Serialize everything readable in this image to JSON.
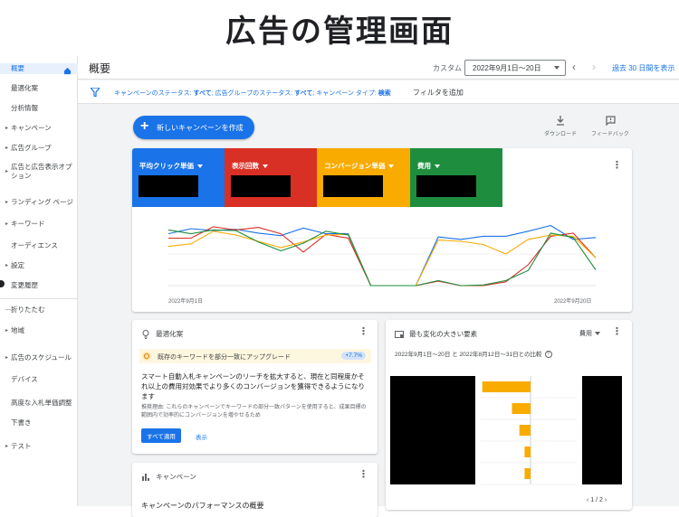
{
  "banner_title": "広告の管理画面",
  "sidebar": {
    "items": [
      {
        "label": "概要",
        "arrow": "",
        "active": true
      },
      {
        "label": "最適化案",
        "arrow": "",
        "sub": true
      },
      {
        "label": "分析情報",
        "arrow": "",
        "sub": true
      },
      {
        "label": "キャンペーン",
        "arrow": "▸"
      },
      {
        "label": "広告グループ",
        "arrow": "▸"
      },
      {
        "label": "広告と広告表示オプション",
        "arrow": "▸"
      },
      {
        "label": "ランディング ページ",
        "arrow": "▸"
      },
      {
        "label": "キーワード",
        "arrow": "▸"
      },
      {
        "label": "オーディエンス",
        "arrow": "",
        "sub": true
      },
      {
        "label": "設定",
        "arrow": "▸"
      },
      {
        "label": "変更履歴",
        "arrow": "",
        "sub": true
      },
      {
        "label": "折りたたむ",
        "arrow": "—"
      },
      {
        "label": "地域",
        "arrow": "▸"
      },
      {
        "label": "広告のスケジュール",
        "arrow": "▸"
      },
      {
        "label": "デバイス",
        "arrow": "",
        "sub": true
      },
      {
        "label": "高度な入札単価調整",
        "arrow": "",
        "sub": true
      },
      {
        "label": "下書き",
        "arrow": "",
        "sub": true
      },
      {
        "label": "テスト",
        "arrow": "▸"
      }
    ]
  },
  "header": {
    "title": "概要",
    "custom_label": "カスタム",
    "date_range": "2022年9月1日～20日",
    "last30": "過去 30 日間を表示"
  },
  "filterbar": {
    "status_text_1": "キャンペーンのステータス: ",
    "status_val_1": "すべて",
    "status_text_2": "; 広告グループのステータス: ",
    "status_val_2": "すべて",
    "status_text_3": "; キャンペーン タイプ: ",
    "status_val_3": "検索",
    "add_filter": "フィルタを追加"
  },
  "toolbar": {
    "new_campaign": "新しいキャンペーンを作成",
    "download": "ダウンロード",
    "feedback": "フィードバック"
  },
  "metrics": [
    {
      "label": "平均クリック単価",
      "color": "#1a73e8"
    },
    {
      "label": "表示回数",
      "color": "#d93025"
    },
    {
      "label": "コンバージョン単価",
      "color": "#f9ab00"
    },
    {
      "label": "費用",
      "color": "#1e8e3e"
    }
  ],
  "chart_data": {
    "type": "line",
    "x": [
      "2022年9月1日",
      "",
      "",
      "",
      "",
      "",
      "",
      "",
      "",
      "",
      "",
      "",
      "",
      "",
      "",
      "",
      "",
      "",
      "",
      "2022年9月20日"
    ],
    "x_start_label": "2022年9月1日",
    "x_end_label": "2022年9月20日",
    "series": [
      {
        "color": "#1a73e8",
        "values": [
          0.82,
          0.9,
          0.87,
          0.89,
          0.83,
          0.79,
          0.91,
          0.82,
          0.82,
          0.0,
          0.0,
          0.0,
          0.77,
          0.73,
          0.78,
          0.78,
          0.86,
          0.95,
          0.73,
          0.76
        ]
      },
      {
        "color": "#d93025",
        "values": [
          0.75,
          0.75,
          0.93,
          0.88,
          0.92,
          0.82,
          0.53,
          0.81,
          0.75,
          0.0,
          0.0,
          0.0,
          0.07,
          0.0,
          0.0,
          0.06,
          0.33,
          0.78,
          0.83,
          0.44
        ]
      },
      {
        "color": "#f9ab00",
        "values": [
          0.62,
          0.66,
          0.86,
          0.8,
          0.7,
          0.6,
          0.69,
          0.8,
          0.81,
          0.0,
          0.0,
          0.0,
          0.72,
          0.7,
          0.65,
          0.5,
          0.73,
          0.8,
          0.78,
          0.44
        ]
      },
      {
        "color": "#1e8e3e",
        "values": [
          0.88,
          0.82,
          0.88,
          0.87,
          0.69,
          0.55,
          0.67,
          0.86,
          0.8,
          0.0,
          0.0,
          0.0,
          0.08,
          0.0,
          0.01,
          0.08,
          0.24,
          0.83,
          0.76,
          0.25
        ]
      }
    ],
    "ylim": [
      0,
      1
    ],
    "grid": true
  },
  "optimization_card": {
    "title": "最適化案",
    "rec_label": "既存のキーワードを部分一致にアップグレード",
    "rec_badge": "+7.7%",
    "main_text": "スマート自動入札キャンペーンのリーチを拡大すると、現在と同程度かそれ以上の費用対効果でより多くのコンバージョンを獲得できるようになります",
    "sub_text": "推奨理由: これらのキャンペーンでキーワードの部分一致パターンを使用すると、成果目標の範囲内で効率的にコンバージョンを増やせるため",
    "apply_all": "すべて適用",
    "view": "表示"
  },
  "campaign_card": {
    "title": "キャンペーン",
    "perf": "キャンペーンのパフォーマンスの概要"
  },
  "change_card": {
    "title": "最も変化の大きい要素",
    "metric_select": "費用",
    "compare_text": "2022年9月1日～20日 と 2022年8月12日～31日との比較",
    "bars": [
      0.65,
      0.25,
      0.15,
      0.08,
      0.08
    ],
    "bar_color": "#f9ab00",
    "pager": "1 / 2"
  }
}
